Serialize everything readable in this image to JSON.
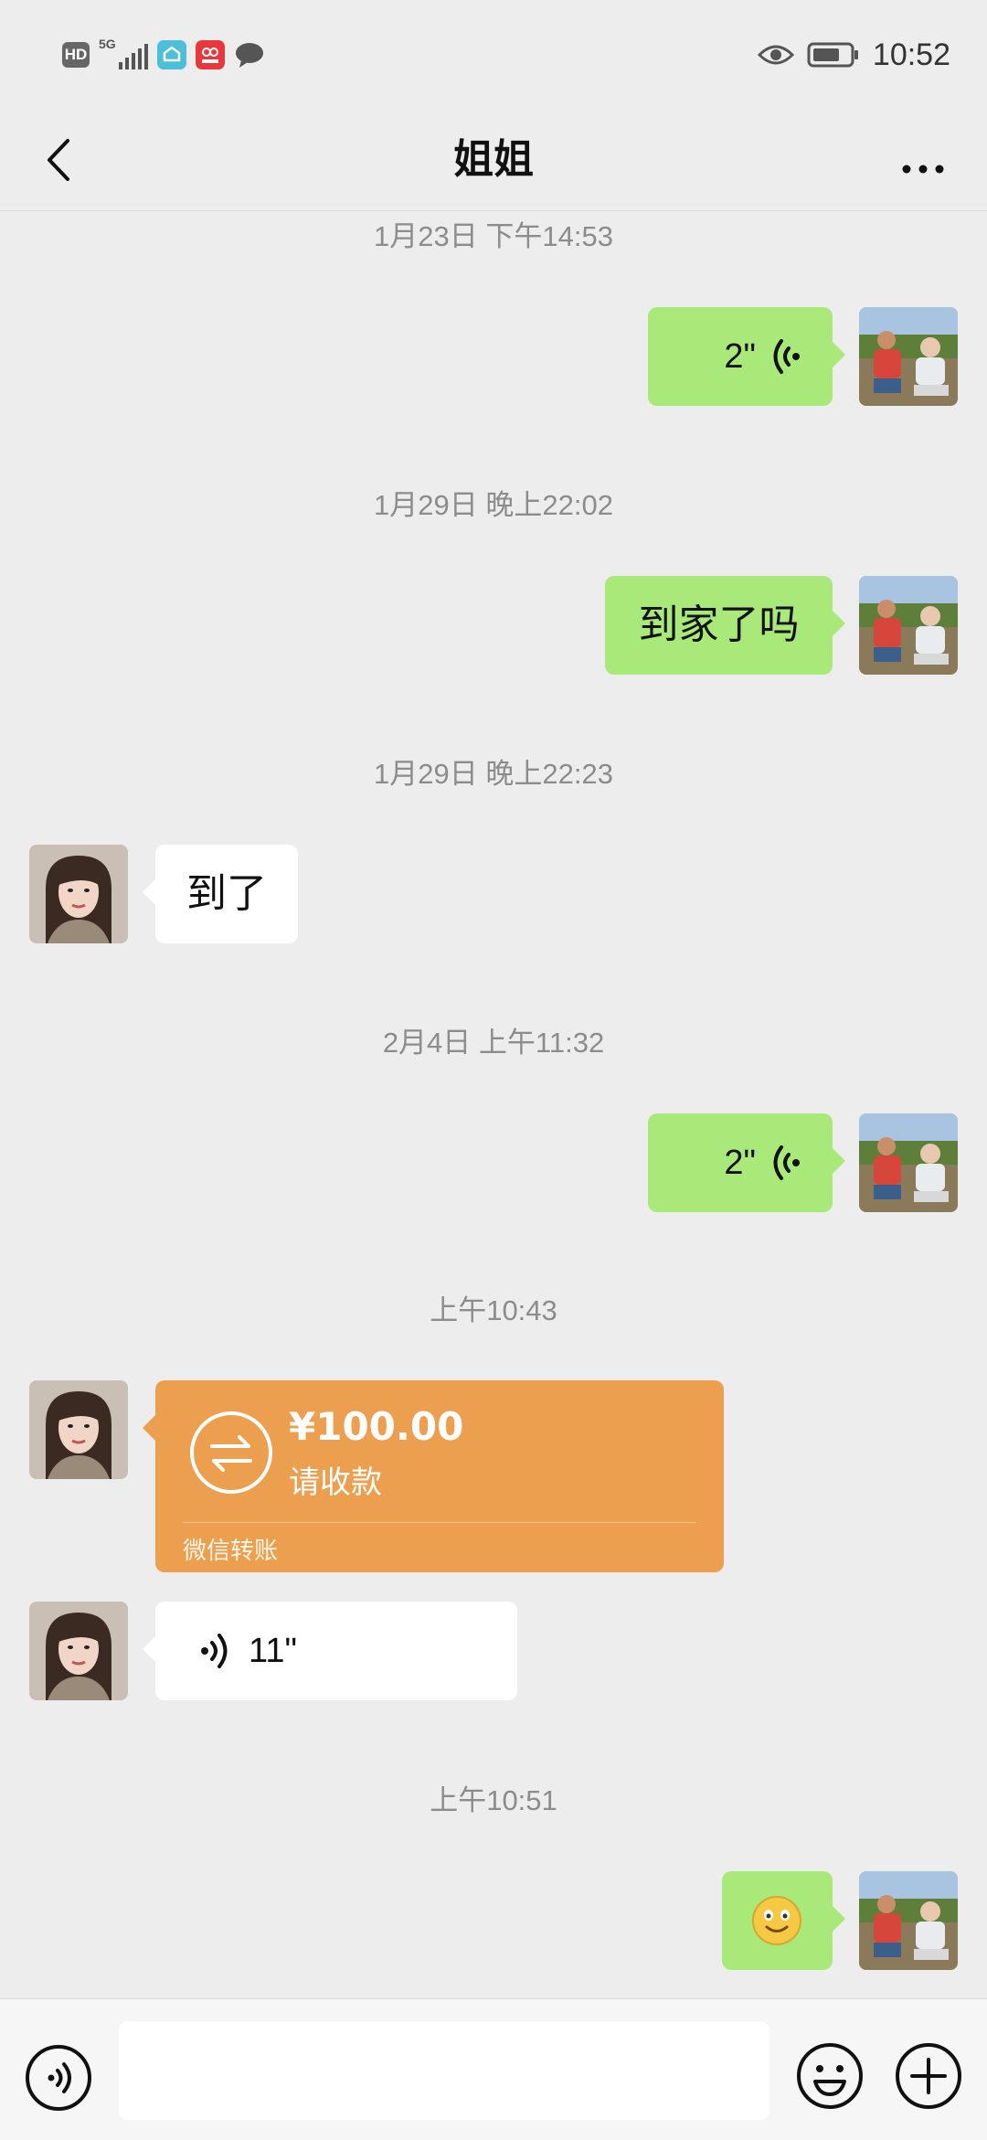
{
  "status_bar": {
    "hd_badge": "HD",
    "network": "5G",
    "time": "10:52"
  },
  "header": {
    "title": "姐姐"
  },
  "messages": [
    {
      "type": "timestamp",
      "text": "1月23日 下午14:53"
    },
    {
      "type": "voice",
      "from": "me",
      "duration": "2\""
    },
    {
      "type": "timestamp",
      "text": "1月29日 晚上22:02"
    },
    {
      "type": "text",
      "from": "me",
      "text": "到家了吗"
    },
    {
      "type": "timestamp",
      "text": "1月29日 晚上22:23"
    },
    {
      "type": "text",
      "from": "them",
      "text": "到了"
    },
    {
      "type": "timestamp",
      "text": "2月4日 上午11:32"
    },
    {
      "type": "voice",
      "from": "me",
      "duration": "2\""
    },
    {
      "type": "timestamp",
      "text": "上午10:43"
    },
    {
      "type": "transfer",
      "from": "them",
      "amount": "¥100.00",
      "status": "请收款",
      "label": "微信转账"
    },
    {
      "type": "voice",
      "from": "them",
      "duration": "11\""
    },
    {
      "type": "timestamp",
      "text": "上午10:51"
    },
    {
      "type": "emoji",
      "from": "me",
      "icon": "smile-emoji-icon"
    }
  ],
  "input_bar": {
    "placeholder": ""
  },
  "colors": {
    "background": "#ededed",
    "my_bubble": "#a9e97a",
    "their_bubble": "#ffffff",
    "transfer": "#ec9f4f"
  }
}
